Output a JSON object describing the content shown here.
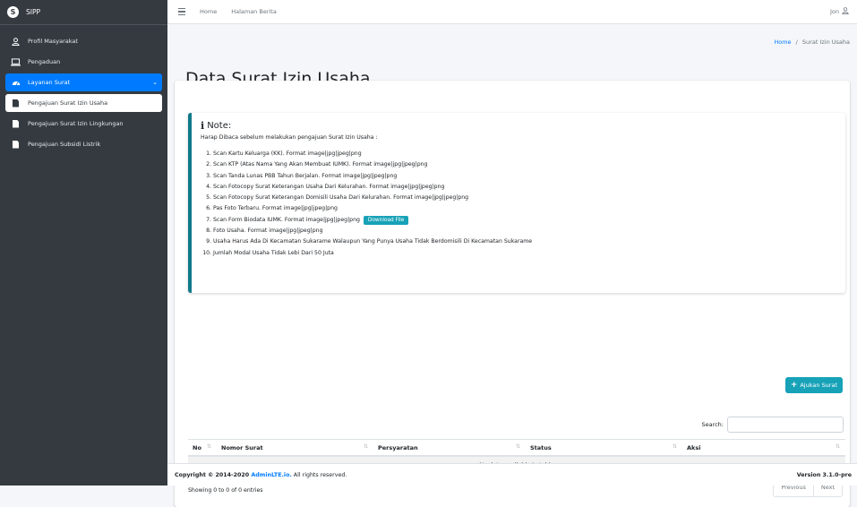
{
  "brand": {
    "logo_letter": "S",
    "name": "SIPP"
  },
  "sidebar": {
    "items": [
      {
        "label": "Profil Masyarakat",
        "icon": "user-icon"
      },
      {
        "label": "Pengaduan",
        "icon": "laptop-icon"
      },
      {
        "label": "Layanan Surat",
        "icon": "tachometer-icon",
        "caret": "⌄"
      },
      {
        "label": "Pengajuan Surat Izin Usaha",
        "icon": "file-icon"
      },
      {
        "label": "Pengajuan Surat Izin Lingkungan",
        "icon": "file-icon"
      },
      {
        "label": "Pengajuan Subsidi Listrik",
        "icon": "file-icon"
      }
    ]
  },
  "topbar": {
    "links": [
      "Home",
      "Halaman Berita"
    ],
    "user": "Jon"
  },
  "breadcrumb": {
    "home": "Home",
    "separator": "/",
    "current": "Surat Izin Usaha"
  },
  "page": {
    "title": "Data Surat Izin Usaha"
  },
  "note": {
    "icon_glyph": "i",
    "title": "Note:",
    "intro": "Harap Dibaca sebelum melakukan pengajuan Surat Izin Usaha :",
    "items": [
      "Scan Kartu Keluarga (KK). Format image|jpg|jpeg|png",
      "Scan KTP (Atas Nama Yang Akan Membuat IUMK). Format image|jpg|jpeg|png",
      "Scan Tanda Lunas PBB Tahun Berjalan. Format image|jpg|jpeg|png",
      "Scan Fotocopy Surat Keterangan Usaha Dari Kelurahan. Format image|jpg|jpeg|png",
      "Scan Fotocopy Surat Keterangan Domisili Usaha Dari Kelurahan. Format image|jpg|jpeg|png",
      "Pas Foto Terbaru. Format image|jpg|jpeg|png",
      "Scan Form Biodata IUMK. Format image|jpg|jpeg|png",
      "Foto Usaha. Format image|jpg|jpeg|png",
      "Usaha Harus Ada Di Kecamatan Sukarame Walaupun Yang Punya Usaha Tidak Berdomisili Di Kecamatan Sukarame",
      "Jumlah Modal Usaha Tidak Lebi Dari 50 Juta"
    ],
    "download_label": "Download File"
  },
  "actions": {
    "ajukan_label": "Ajukan Surat"
  },
  "table": {
    "search_label": "Search:",
    "search_value": "",
    "columns": [
      "No",
      "Nomor Surat",
      "Persyaratan",
      "Status",
      "Aksi"
    ],
    "empty_message": "No data available in table",
    "info": "Showing 0 to 0 of 0 entries",
    "previous": "Previous",
    "next": "Next"
  },
  "footer": {
    "copyright_prefix": "Copyright © 2014-2020 ",
    "copyright_link": "AdminLTE.io.",
    "copyright_suffix": " All rights reserved.",
    "version": "Version 3.1.0-pre"
  }
}
